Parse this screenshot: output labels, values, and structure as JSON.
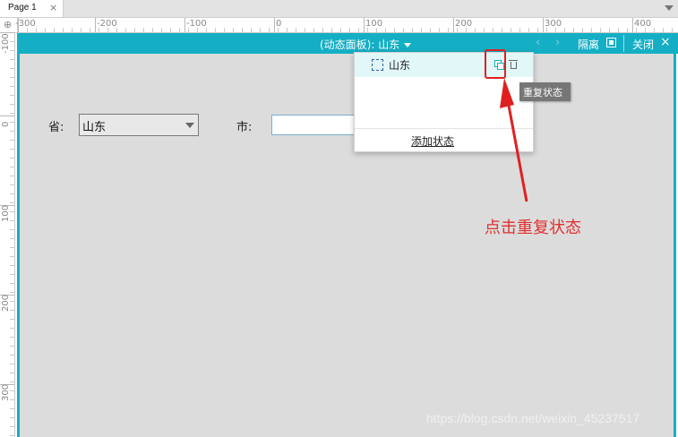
{
  "tab": {
    "label": "Page 1",
    "close": "×"
  },
  "ruler": {
    "h_labels": [
      "-300",
      "-200",
      "-100",
      "0",
      "100",
      "200",
      "300",
      "400"
    ],
    "v_labels": [
      "-100",
      "0",
      "100",
      "200",
      "300"
    ]
  },
  "panel": {
    "title": "(动态面板): 山东",
    "isolate_label": "隔离",
    "close_label": "关闭",
    "close_x": "×",
    "prev": "‹",
    "next": "›"
  },
  "form": {
    "province_label": "省:",
    "province_value": "山东",
    "city_label": "市:",
    "city_value": ""
  },
  "states_popover": {
    "state_name": "山东",
    "add_state_label": "添加状态"
  },
  "tooltip": {
    "text": "重复状态"
  },
  "annotation": {
    "text": "点击重复状态",
    "color": "#e03030"
  },
  "watermark": {
    "text": "https://blog.csdn.net/weixin_45237517"
  },
  "colors": {
    "accent": "#14afc4",
    "canvas": "#dcdcdc",
    "annotation_red": "#e02020"
  },
  "icons": [
    "corner-crosshair-icon",
    "chevron-down-icon",
    "isolate-icon",
    "close-icon",
    "state-checkbox-icon",
    "duplicate-icon",
    "trash-icon"
  ]
}
